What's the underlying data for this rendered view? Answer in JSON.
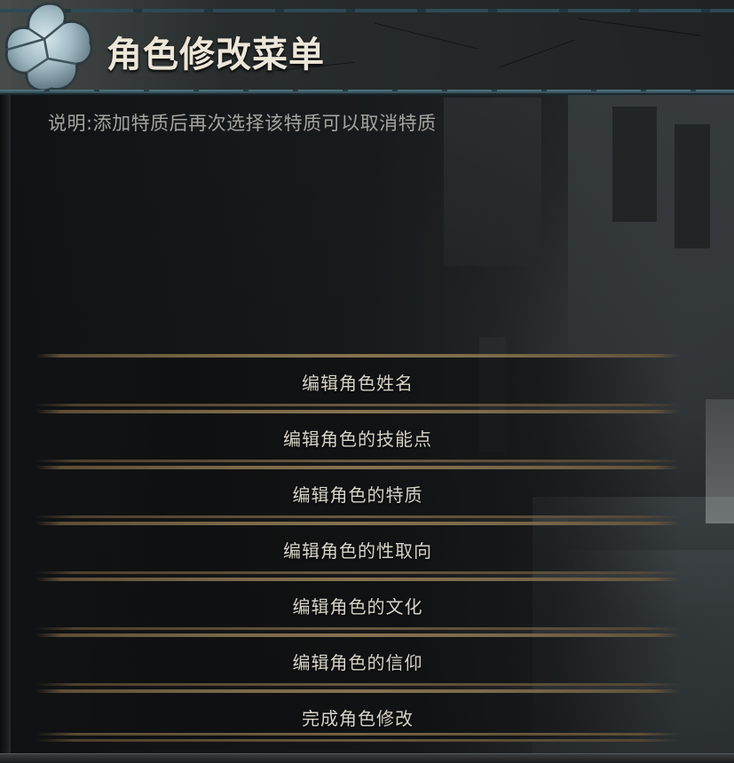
{
  "header": {
    "title": "角色修改菜单"
  },
  "description": "说明:添加特质后再次选择该特质可以取消特质",
  "menu": {
    "items": [
      {
        "label": "编辑角色姓名"
      },
      {
        "label": "编辑角色的技能点"
      },
      {
        "label": "编辑角色的特质"
      },
      {
        "label": "编辑角色的性取向"
      },
      {
        "label": "编辑角色的文化"
      },
      {
        "label": "编辑角色的信仰"
      },
      {
        "label": "完成角色修改"
      }
    ]
  },
  "colors": {
    "title": "#ece6d8",
    "description": "#a6a49f",
    "menu_text": "#d9d4c8",
    "menu_divider": "#8d7650",
    "header_trim": "#3a5560"
  },
  "icons": {
    "emblem": "stone-emblem-icon"
  }
}
